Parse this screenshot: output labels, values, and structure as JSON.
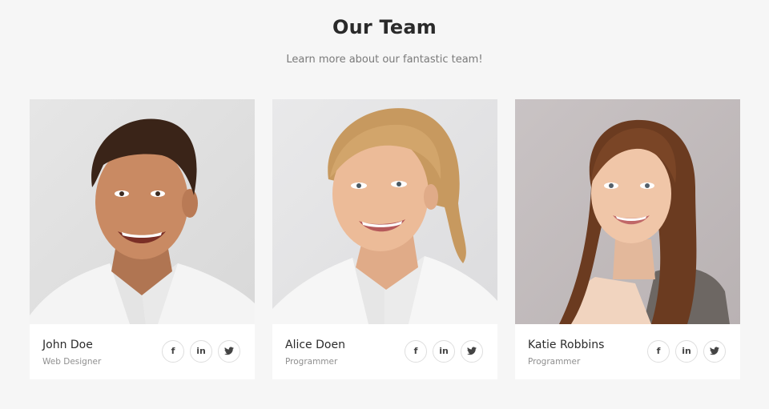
{
  "section": {
    "title": "Our Team",
    "subtitle": "Learn more about our fantastic team!"
  },
  "members": [
    {
      "name": "John Doe",
      "role": "Web Designer",
      "photo": "portrait-man-smiling",
      "socials": [
        "facebook-icon",
        "linkedin-icon",
        "twitter-icon"
      ]
    },
    {
      "name": "Alice Doen",
      "role": "Programmer",
      "photo": "portrait-woman-blonde",
      "socials": [
        "facebook-icon",
        "linkedin-icon",
        "twitter-icon"
      ]
    },
    {
      "name": "Katie Robbins",
      "role": "Programmer",
      "photo": "portrait-woman-brunette",
      "socials": [
        "facebook-icon",
        "linkedin-icon",
        "twitter-icon"
      ]
    }
  ],
  "social_glyphs": {
    "facebook": "f",
    "linkedin": "in"
  },
  "colors": {
    "page_background": "#f6f6f6",
    "card_background": "#ffffff",
    "title": "#2a2a2a",
    "muted_text": "#8f8f8f",
    "icon_border": "#dedede"
  }
}
